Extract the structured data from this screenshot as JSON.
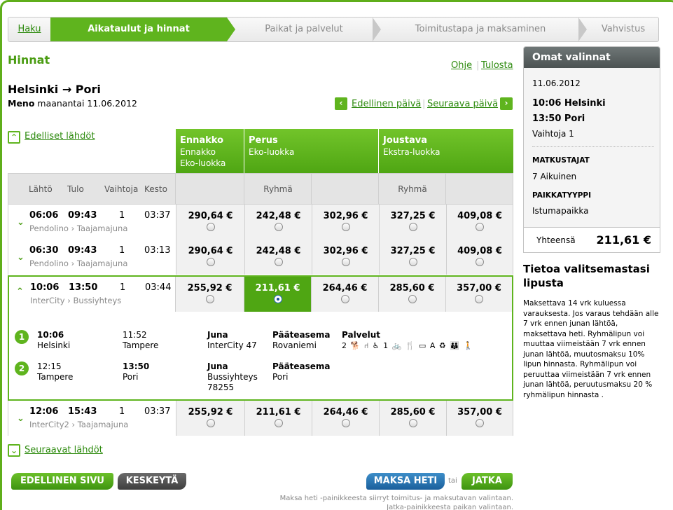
{
  "steps": [
    "Haku",
    "Aikataulut ja hinnat",
    "Paikat ja palvelut",
    "Toimitustapa ja maksaminen",
    "Vahvistus"
  ],
  "heading": "Hinnat",
  "help_link": "Ohje",
  "print_link": "Tulosta",
  "route": "Helsinki → Pori",
  "direction_label": "Meno",
  "direction_date": "maanantai 11.06.2012",
  "prev_day": "Edellinen päivä",
  "next_day": "Seuraava päivä",
  "prev_departures": "Edelliset lähdöt",
  "next_departures": "Seuraavat lähdöt",
  "fare_groups": [
    {
      "name": "Ennakko",
      "lines": [
        "Ennakko",
        "Eko-luokka"
      ]
    },
    {
      "name": "Perus",
      "lines": [
        "Eko-luokka"
      ]
    },
    {
      "name": "Joustava",
      "lines": [
        "Ekstra-luokka"
      ]
    }
  ],
  "col_headers": {
    "depart": "Lähtö",
    "arrive": "Tulo",
    "changes": "Vaihtoja",
    "duration": "Kesto",
    "group1": "Ryhmä",
    "group2": "Ryhmä"
  },
  "trips": [
    {
      "dep": "06:06",
      "arr": "09:43",
      "changes": "1",
      "dur": "03:37",
      "trains": "Pendolino › Taajamajuna",
      "prices": [
        "290,64 €",
        "242,48 €",
        "302,96 €",
        "327,25 €",
        "409,08 €"
      ],
      "toggle": "⌄"
    },
    {
      "dep": "06:30",
      "arr": "09:43",
      "changes": "1",
      "dur": "03:13",
      "trains": "Pendolino › Taajamajuna",
      "prices": [
        "290,64 €",
        "242,48 €",
        "302,96 €",
        "327,25 €",
        "409,08 €"
      ],
      "toggle": "⌄"
    },
    {
      "dep": "10:06",
      "arr": "13:50",
      "changes": "1",
      "dur": "03:44",
      "trains": "InterCity › Bussiyhteys",
      "prices": [
        "255,92 €",
        "211,61 €",
        "264,46 €",
        "285,60 €",
        "357,00 €"
      ],
      "toggle": "⌃"
    },
    {
      "dep": "12:06",
      "arr": "15:43",
      "changes": "1",
      "dur": "03:37",
      "trains": "InterCity2 › Taajamajuna",
      "prices": [
        "255,92 €",
        "211,61 €",
        "264,46 €",
        "285,60 €",
        "357,00 €"
      ],
      "toggle": "⌄"
    }
  ],
  "legs": [
    {
      "num": "1",
      "dep_time": "10:06",
      "dep_place": "Helsinki",
      "arr_time": "11:52",
      "arr_place": "Tampere",
      "type": "Juna",
      "vehicle": "InterCity 47",
      "dest_label": "Pääteasema",
      "dest": "Rovaniemi"
    },
    {
      "num": "2",
      "dep_time": "12:15",
      "dep_place": "Tampere",
      "arr_time": "13:50",
      "arr_place": "Pori",
      "type": "Juna",
      "vehicle": "Bussiyhteys 78255",
      "dest_label": "Pääteasema",
      "dest": "Pori"
    }
  ],
  "services_label": "Palvelut",
  "services_icons": "2 🐕 ⑁ ♿ 1 🚲 🍴 ▭ A ♻ 👪 🚶",
  "buttons": {
    "prev_page": "EDELLINEN SIVU",
    "cancel": "KESKEYTÄ",
    "pay_now": "MAKSA HETI",
    "or": "tai",
    "continue": "JATKA"
  },
  "footer_note": "Maksa heti -painikkeesta siirryt toimitus- ja maksutavan valintaan. Jatka-painikkeesta paikan valintaan.",
  "panel": {
    "title": "Omat valinnat",
    "date": "11.06.2012",
    "dep": "10:06 Helsinki",
    "arr": "13:50 Pori",
    "changes": "Vaihtoja 1",
    "travellers_label": "MATKUSTAJAT",
    "travellers": "7 Aikuinen",
    "seat_label": "PAIKKATYYPPI",
    "seat": "Istumapaikka",
    "total_label": "Yhteensä",
    "total": "211,61 €"
  },
  "info_title": "Tietoa valitsemastasi lipusta",
  "info_text": "Maksettava 14 vrk kuluessa varauksesta. Jos varaus tehdään alle 7 vrk ennen junan lähtöä, maksettava heti. Ryhmälipun voi muuttaa viimeistään 7 vrk ennen junan lähtöä, muutosmaksu 10% lipun hinnasta. Ryhmälipun voi peruuttaa viimeistään 7 vrk ennen junan lähtöä, peruutusmaksu 20 % ryhmälipun hinnasta ."
}
